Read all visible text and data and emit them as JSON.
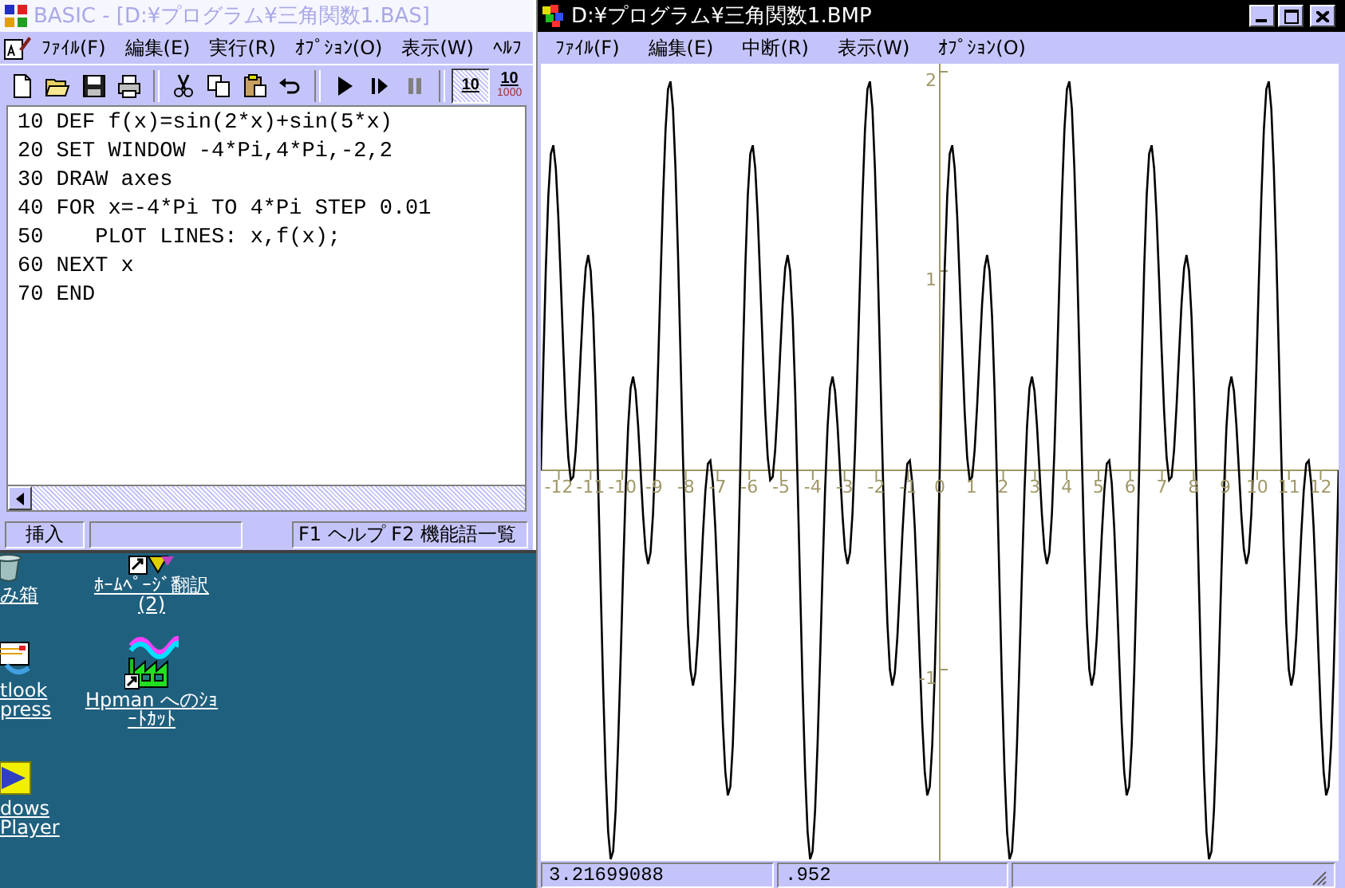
{
  "editor_window": {
    "title": "BASIC - [D:¥プログラム¥三角関数1.BAS]",
    "active": false,
    "menu": [
      "ﾌｧｲﾙ(F)",
      "編集(E)",
      "実行(R)",
      "ｵﾌﾟｼｮﾝ(O)",
      "表示(W)",
      "ﾍﾙﾌ"
    ],
    "toolbar": [
      {
        "kind": "new"
      },
      {
        "kind": "open"
      },
      {
        "kind": "save"
      },
      {
        "kind": "print"
      },
      {
        "kind": "separator"
      },
      {
        "kind": "cut"
      },
      {
        "kind": "copy"
      },
      {
        "kind": "paste"
      },
      {
        "kind": "undo"
      },
      {
        "kind": "separator"
      },
      {
        "kind": "run"
      },
      {
        "kind": "step"
      },
      {
        "kind": "pause"
      },
      {
        "kind": "separator"
      },
      {
        "kind": "toggle",
        "label": "10",
        "selected": true
      },
      {
        "kind": "toggle",
        "label": "10",
        "sublabel": "1000",
        "selected": false
      }
    ],
    "code_lines": [
      "10 DEF f(x)=sin(2*x)+sin(5*x)",
      "20 SET WINDOW -4*Pi,4*Pi,-2,2",
      "30 DRAW axes",
      "40 FOR x=-4*Pi TO 4*Pi STEP 0.01",
      "50    PLOT LINES: x,f(x);",
      "60 NEXT x",
      "70 END"
    ],
    "status_bar": {
      "mode": "挿入",
      "hint": "F1 ヘルプ  F2 機能語一覧"
    }
  },
  "desktop_icons": [
    {
      "kind": "trash",
      "label": "み箱"
    },
    {
      "kind": "web-shortcut",
      "label": "ﾎｰﾑﾍﾟｰｼﾞ翻訳 (2)"
    },
    {
      "kind": "mail",
      "label": "tlook\npress"
    },
    {
      "kind": "factory",
      "label": "Hpman へのｼｮｰﾄｶｯﾄ"
    },
    {
      "kind": "player",
      "label": "dows\n Player"
    }
  ],
  "graph_window": {
    "title": "D:¥プログラム¥三角関数1.BMP",
    "active": true,
    "menu": [
      "ﾌｧｲﾙ(F)",
      "編集(E)",
      "中断(R)",
      "表示(W)",
      "ｵﾌﾟｼｮﾝ(O)"
    ],
    "chart_data": {
      "type": "line",
      "xlim": [
        -12.566,
        12.566
      ],
      "ylim": [
        -1.96,
        2.04
      ],
      "xticks": [
        -12,
        -11,
        -10,
        -9,
        -8,
        -7,
        -6,
        -5,
        -4,
        -3,
        -2,
        -1,
        0,
        1,
        2,
        3,
        4,
        5,
        6,
        7,
        8,
        9,
        10,
        11,
        12
      ],
      "yticks": [
        -1,
        1,
        2
      ],
      "x": [
        -12.566,
        -12.488,
        -12.409,
        -12.331,
        -12.252,
        -12.174,
        -12.095,
        -12.017,
        -11.938,
        -11.859,
        -11.781,
        -11.702,
        -11.624,
        -11.545,
        -11.467,
        -11.388,
        -11.31,
        -11.231,
        -11.153,
        -11.074,
        -10.996,
        -10.917,
        -10.838,
        -10.76,
        -10.681,
        -10.603,
        -10.524,
        -10.446,
        -10.367,
        -10.289,
        -10.21,
        -10.132,
        -10.053,
        -9.975,
        -9.896,
        -9.817,
        -9.739,
        -9.66,
        -9.582,
        -9.503,
        -9.425,
        -9.346,
        -9.268,
        -9.189,
        -9.111,
        -9.032,
        -8.954,
        -8.875,
        -8.796,
        -8.718,
        -8.639,
        -8.561,
        -8.482,
        -8.404,
        -8.325,
        -8.247,
        -8.168,
        -8.09,
        -8.011,
        -7.933,
        -7.854,
        -7.775,
        -7.697,
        -7.618,
        -7.54,
        -7.461,
        -7.383,
        -7.304,
        -7.226,
        -7.147,
        -7.069,
        -6.99,
        -6.912,
        -6.833,
        -6.754,
        -6.676,
        -6.597,
        -6.519,
        -6.441,
        -6.362,
        -6.283,
        -6.205,
        -6.126,
        -6.048,
        -5.969,
        -5.89,
        -5.812,
        -5.733,
        -5.655,
        -5.576,
        -5.498,
        -5.419,
        -5.341,
        -5.262,
        -5.184,
        -5.105,
        -5.027,
        -4.948,
        -4.869,
        -4.791,
        -4.712,
        -4.634,
        -4.555,
        -4.477,
        -4.398,
        -4.32,
        -4.241,
        -4.163,
        -4.084,
        -4.006,
        -3.927,
        -3.848,
        -3.77,
        -3.691,
        -3.613,
        -3.534,
        -3.456,
        -3.377,
        -3.299,
        -3.22,
        -3.142,
        -3.063,
        -2.985,
        -2.906,
        -2.827,
        -2.749,
        -2.67,
        -2.592,
        -2.513,
        -2.435,
        -2.356,
        -2.278,
        -2.199,
        -2.121,
        -2.042,
        -1.963,
        -1.885,
        -1.806,
        -1.728,
        -1.649,
        -1.571,
        -1.492,
        -1.414,
        -1.335,
        -1.257,
        -1.178,
        -1.1,
        -1.021,
        -0.942,
        -0.864,
        -0.785,
        -0.707,
        -0.628,
        -0.55,
        -0.471,
        -0.393,
        -0.314,
        -0.236,
        -0.157,
        -0.079,
        0,
        0.079,
        0.157,
        0.236,
        0.314,
        0.393,
        0.471,
        0.55,
        0.628,
        0.707,
        0.785,
        0.864,
        0.942,
        1.021,
        1.1,
        1.178,
        1.257,
        1.335,
        1.414,
        1.492,
        1.571,
        1.649,
        1.728,
        1.806,
        1.885,
        1.963,
        2.042,
        2.121,
        2.199,
        2.278,
        2.356,
        2.435,
        2.513,
        2.592,
        2.67,
        2.749,
        2.827,
        2.906,
        2.985,
        3.063,
        3.142,
        3.22,
        3.299,
        3.377,
        3.456,
        3.534,
        3.613,
        3.691,
        3.77,
        3.848,
        3.927,
        4.006,
        4.084,
        4.163,
        4.241,
        4.32,
        4.398,
        4.477,
        4.555,
        4.634,
        4.712,
        4.791,
        4.869,
        4.948,
        5.027,
        5.105,
        5.184,
        5.262,
        5.341,
        5.419,
        5.498,
        5.576,
        5.655,
        5.733,
        5.812,
        5.89,
        5.969,
        6.048,
        6.126,
        6.205,
        6.283,
        6.362,
        6.441,
        6.519,
        6.597,
        6.676,
        6.754,
        6.833,
        6.912,
        6.99,
        7.069,
        7.147,
        7.226,
        7.304,
        7.383,
        7.461,
        7.54,
        7.618,
        7.697,
        7.775,
        7.854,
        7.933,
        8.011,
        8.09,
        8.168,
        8.247,
        8.325,
        8.404,
        8.482,
        8.561,
        8.639,
        8.718,
        8.796,
        8.875,
        8.954,
        9.032,
        9.111,
        9.189,
        9.268,
        9.346,
        9.425,
        9.503,
        9.582,
        9.66,
        9.739,
        9.817,
        9.896,
        9.975,
        10.053,
        10.132,
        10.21,
        10.289,
        10.367,
        10.446,
        10.524,
        10.603,
        10.681,
        10.76,
        10.838,
        10.917,
        10.996,
        11.074,
        11.153,
        11.231,
        11.31,
        11.388,
        11.467,
        11.545,
        11.624,
        11.702,
        11.781,
        11.859,
        11.938,
        12.017,
        12.095,
        12.174,
        12.252,
        12.331,
        12.409,
        12.488,
        12.566
      ],
      "values": [
        0,
        0.539,
        1.016,
        1.378,
        1.588,
        1.631,
        1.516,
        1.274,
        0.951,
        0.605,
        0.293,
        0.064,
        -0.049,
        -0.033,
        0.102,
        0.324,
        0.588,
        0.837,
        1.016,
        1.08,
        1,
        0.768,
        0.398,
        -0.071,
        -0.588,
        -1.09,
        -1.516,
        -1.815,
        -1.951,
        -1.912,
        -1.707,
        -1.37,
        -0.951,
        -0.508,
        -0.102,
        0.217,
        0.412,
        0.47,
        0.398,
        0.226,
        0,
        -0.226,
        -0.398,
        -0.47,
        -0.412,
        -0.217,
        0.102,
        0.508,
        0.951,
        1.37,
        1.707,
        1.912,
        1.951,
        1.815,
        1.516,
        1.09,
        0.588,
        0.071,
        -0.398,
        -0.768,
        -1,
        -1.08,
        -1.016,
        -0.837,
        -0.588,
        -0.324,
        -0.102,
        0.033,
        0.049,
        -0.064,
        -0.293,
        -0.605,
        -0.951,
        -1.274,
        -1.516,
        -1.631,
        -1.588,
        -1.378,
        -1.016,
        -0.539,
        0,
        0.539,
        1.016,
        1.378,
        1.588,
        1.631,
        1.516,
        1.274,
        0.951,
        0.605,
        0.293,
        0.064,
        -0.049,
        -0.033,
        0.102,
        0.324,
        0.588,
        0.837,
        1.016,
        1.08,
        1,
        0.768,
        0.398,
        -0.071,
        -0.588,
        -1.09,
        -1.516,
        -1.815,
        -1.951,
        -1.912,
        -1.707,
        -1.37,
        -0.951,
        -0.508,
        -0.102,
        0.217,
        0.412,
        0.47,
        0.398,
        0.226,
        0,
        -0.226,
        -0.398,
        -0.47,
        -0.412,
        -0.217,
        0.102,
        0.508,
        0.951,
        1.37,
        1.707,
        1.912,
        1.951,
        1.815,
        1.516,
        1.09,
        0.588,
        0.071,
        -0.398,
        -0.768,
        -1,
        -1.08,
        -1.016,
        -0.837,
        -0.588,
        -0.324,
        -0.102,
        0.033,
        0.049,
        -0.064,
        -0.293,
        -0.605,
        -0.951,
        -1.274,
        -1.516,
        -1.631,
        -1.588,
        -1.378,
        -1.016,
        -0.539,
        0,
        0.539,
        1.016,
        1.378,
        1.588,
        1.631,
        1.516,
        1.274,
        0.951,
        0.605,
        0.293,
        0.064,
        -0.049,
        -0.033,
        0.102,
        0.324,
        0.588,
        0.837,
        1.016,
        1.08,
        1,
        0.768,
        0.398,
        -0.071,
        -0.588,
        -1.09,
        -1.516,
        -1.815,
        -1.951,
        -1.912,
        -1.707,
        -1.37,
        -0.951,
        -0.508,
        -0.102,
        0.217,
        0.412,
        0.47,
        0.398,
        0.226,
        0,
        -0.226,
        -0.398,
        -0.47,
        -0.412,
        -0.217,
        0.102,
        0.508,
        0.951,
        1.37,
        1.707,
        1.912,
        1.951,
        1.815,
        1.516,
        1.09,
        0.588,
        0.071,
        -0.398,
        -0.768,
        -1,
        -1.08,
        -1.016,
        -0.837,
        -0.588,
        -0.324,
        -0.102,
        0.033,
        0.049,
        -0.064,
        -0.293,
        -0.605,
        -0.951,
        -1.274,
        -1.516,
        -1.631,
        -1.588,
        -1.378,
        -1.016,
        -0.539,
        0,
        0.539,
        1.016,
        1.378,
        1.588,
        1.631,
        1.516,
        1.274,
        0.951,
        0.605,
        0.293,
        0.064,
        -0.049,
        -0.033,
        0.102,
        0.324,
        0.588,
        0.837,
        1.016,
        1.08,
        1,
        0.768,
        0.398,
        -0.071,
        -0.588,
        -1.09,
        -1.516,
        -1.815,
        -1.951,
        -1.912,
        -1.707,
        -1.37,
        -0.951,
        -0.508,
        -0.102,
        0.217,
        0.412,
        0.47,
        0.398,
        0.226,
        0,
        -0.226,
        -0.398,
        -0.47,
        -0.412,
        -0.217,
        0.102,
        0.508,
        0.951,
        1.37,
        1.707,
        1.912,
        1.951,
        1.815,
        1.516,
        1.09,
        0.588,
        0.071,
        -0.398,
        -0.768,
        -1,
        -1.08,
        -1.016,
        -0.837,
        -0.588,
        -0.324,
        -0.102,
        0.033,
        0.049,
        -0.064,
        -0.293,
        -0.605,
        -0.951,
        -1.274,
        -1.516,
        -1.631,
        -1.588,
        -1.378,
        -1.016,
        -0.539,
        0
      ]
    },
    "status_bar": [
      "3.21699088",
      ".952"
    ]
  }
}
